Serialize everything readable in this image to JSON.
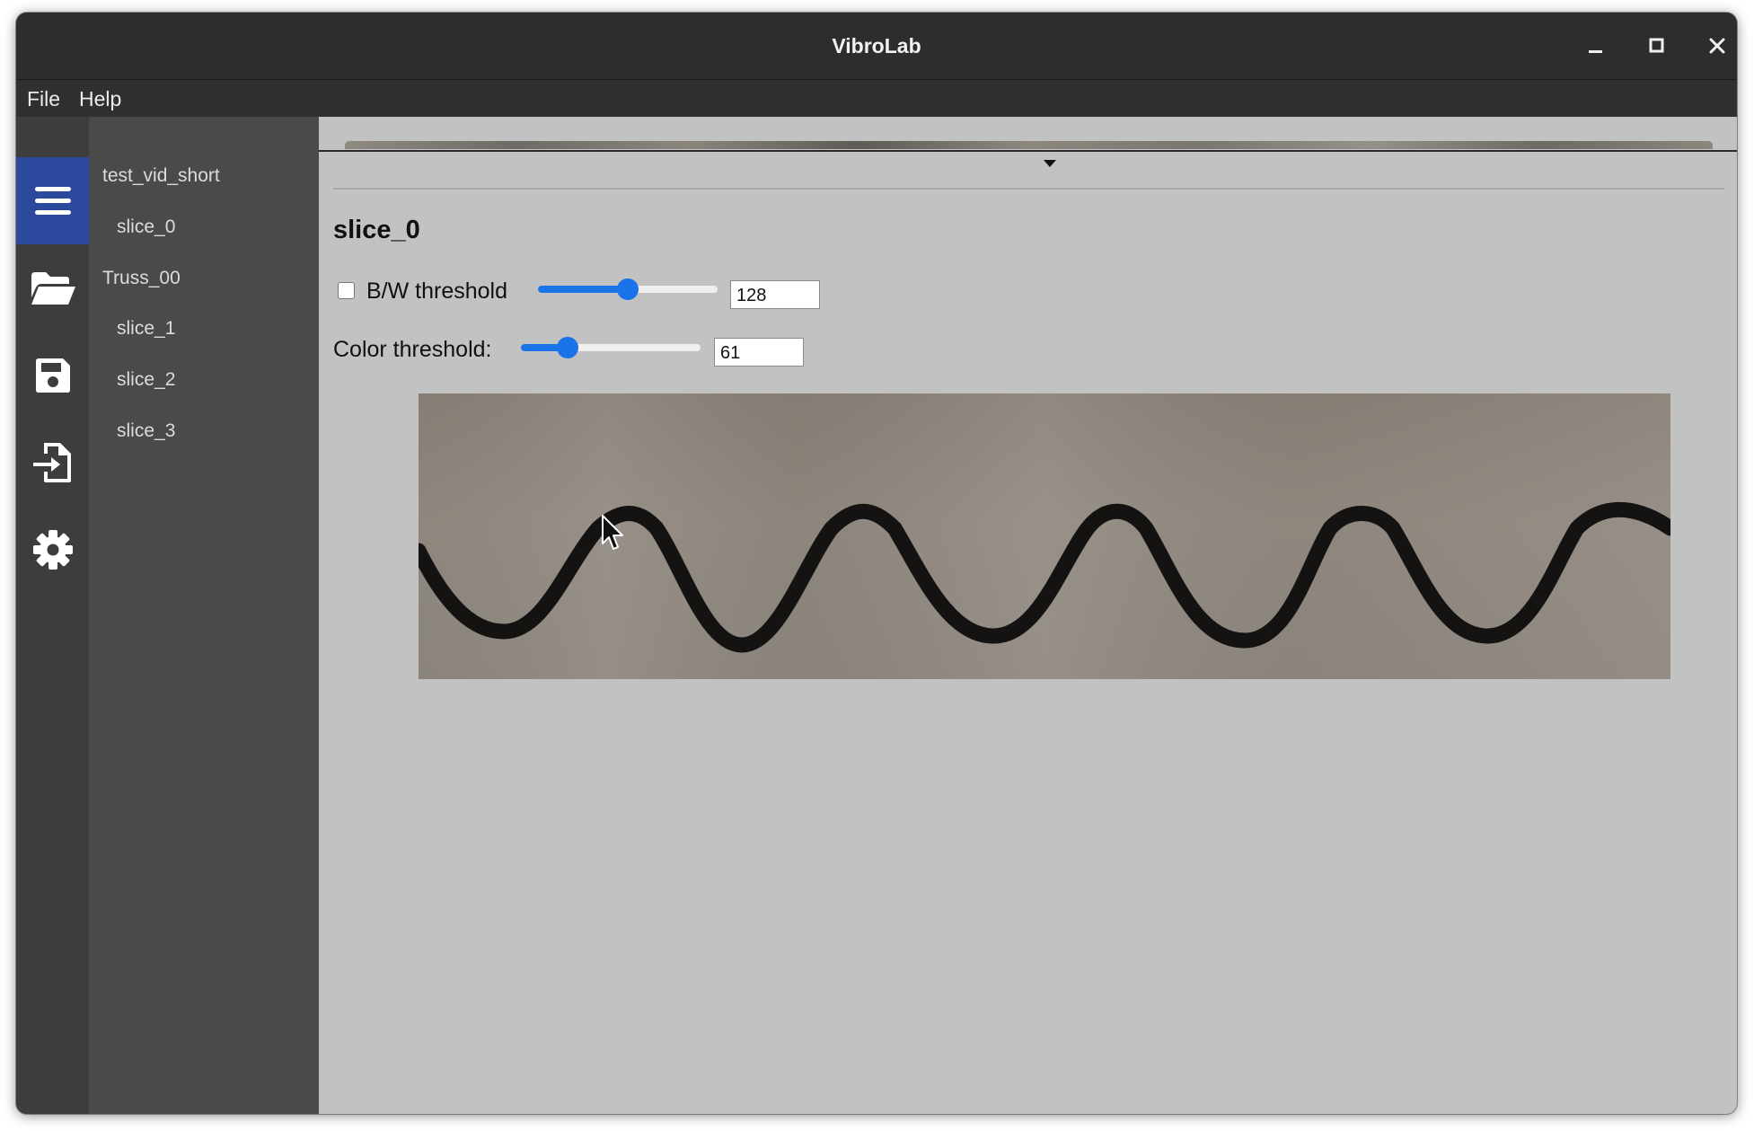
{
  "window": {
    "title": "VibroLab",
    "controls": [
      "minimize-icon",
      "maximize-icon",
      "close-icon"
    ]
  },
  "menubar": {
    "items": [
      {
        "label": "File"
      },
      {
        "label": "Help"
      }
    ]
  },
  "iconbar": {
    "active": "menu",
    "items": [
      {
        "name": "menu-icon"
      },
      {
        "name": "open-folder-icon"
      },
      {
        "name": "save-icon"
      },
      {
        "name": "import-icon"
      },
      {
        "name": "settings-icon"
      }
    ],
    "active_color": "#2b4a9d"
  },
  "tree": {
    "items": [
      {
        "label": "test_vid_short",
        "level": 0
      },
      {
        "label": "slice_0",
        "level": 1
      },
      {
        "label": "Truss_00",
        "level": 0
      },
      {
        "label": "slice_1",
        "level": 1
      },
      {
        "label": "slice_2",
        "level": 1
      },
      {
        "label": "slice_3",
        "level": 1
      }
    ]
  },
  "panel": {
    "title": "slice_0",
    "bw": {
      "label": "B/W threshold",
      "checked": false,
      "value": "128",
      "slider_fraction": 0.5
    },
    "color": {
      "label": "Color threshold:",
      "value": "61",
      "slider_fraction": 0.26
    },
    "accent": "#1a73e8"
  }
}
